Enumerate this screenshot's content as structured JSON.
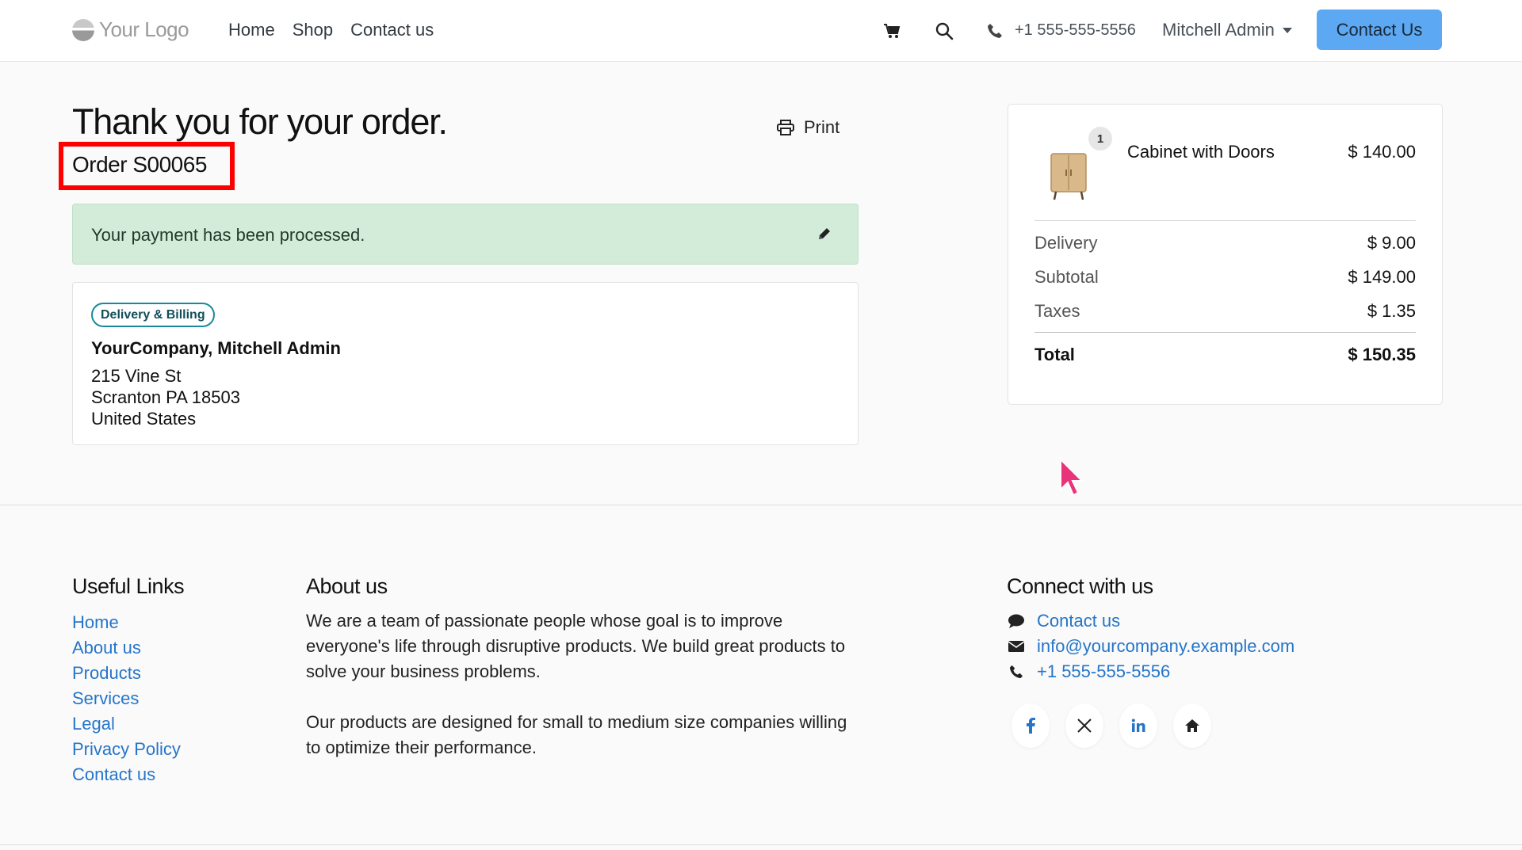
{
  "header": {
    "logo_text": "Your Logo",
    "nav": [
      "Home",
      "Shop",
      "Contact us"
    ],
    "phone": "+1 555-555-5556",
    "user": "Mitchell Admin",
    "cta": "Contact Us",
    "icons": [
      "cart-icon",
      "search-icon",
      "phone-icon"
    ]
  },
  "confirmation": {
    "title": "Thank you for your order.",
    "order": "Order S00065",
    "print_label": "Print",
    "alert": "Your payment has been processed."
  },
  "address": {
    "badge": "Delivery & Billing",
    "name": "YourCompany, Mitchell Admin",
    "line1": "215 Vine St",
    "line2": "Scranton PA 18503",
    "line3": "United States"
  },
  "summary": {
    "product": {
      "name": "Cabinet with Doors",
      "qty": "1",
      "price": "$ 140.00"
    },
    "rows": [
      {
        "label": "Delivery",
        "value": "$ 9.00"
      },
      {
        "label": "Subtotal",
        "value": "$ 149.00"
      },
      {
        "label": "Taxes",
        "value": "$ 1.35"
      }
    ],
    "total": {
      "label": "Total",
      "value": "$ 150.35"
    }
  },
  "footer": {
    "useful_title": "Useful Links",
    "links": [
      "Home",
      "About us",
      "Products",
      "Services",
      "Legal",
      "Privacy Policy",
      "Contact us"
    ],
    "about_title": "About us",
    "about_p1": "We are a team of passionate people whose goal is to improve everyone's life through disruptive products. We build great products to solve your business problems.",
    "about_p2": "Our products are designed for small to medium size companies willing to optimize their performance.",
    "connect_title": "Connect with us",
    "connect": [
      {
        "icon": "comment-icon",
        "text": "Contact us"
      },
      {
        "icon": "envelope-icon",
        "text": "info@yourcompany.example.com"
      },
      {
        "icon": "phone-icon",
        "text": "+1 555-555-5556"
      }
    ],
    "socials": [
      "facebook-icon",
      "x-icon",
      "linkedin-icon",
      "home-icon"
    ]
  },
  "colors": {
    "accent": "#5ca8f2",
    "link": "#2575c9",
    "success_bg": "#d3ecda",
    "highlight": "#ff0000"
  }
}
